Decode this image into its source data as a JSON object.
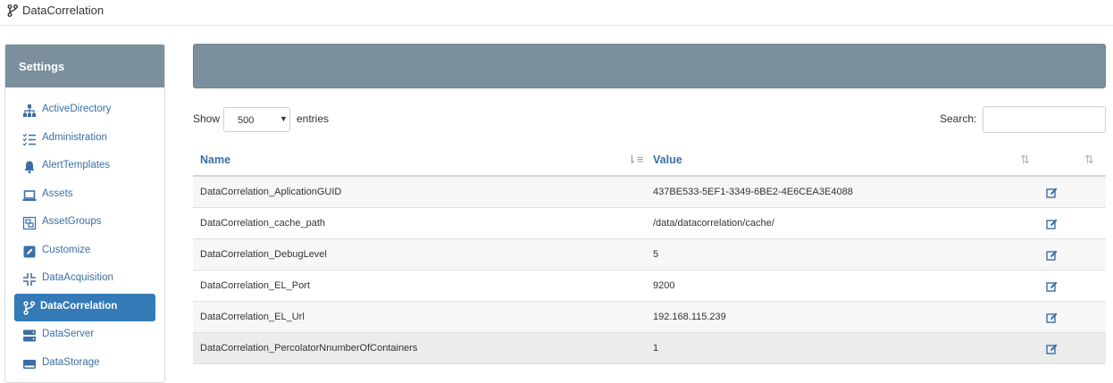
{
  "app": {
    "title": "DataCorrelation"
  },
  "sidebar": {
    "heading": "Settings",
    "items": [
      {
        "label": "ActiveDirectory",
        "icon": "sitemap-icon"
      },
      {
        "label": "Administration",
        "icon": "list-check-icon"
      },
      {
        "label": "AlertTemplates",
        "icon": "bell-icon"
      },
      {
        "label": "Assets",
        "icon": "laptop-icon"
      },
      {
        "label": "AssetGroups",
        "icon": "object-group-icon"
      },
      {
        "label": "Customize",
        "icon": "edit-square-icon"
      },
      {
        "label": "DataAcquisition",
        "icon": "compress-icon"
      },
      {
        "label": "DataCorrelation",
        "icon": "code-branch-icon",
        "active": true
      },
      {
        "label": "DataServer",
        "icon": "server-icon"
      },
      {
        "label": "DataStorage",
        "icon": "hdd-icon"
      }
    ]
  },
  "controls": {
    "show_label": "Show",
    "entries_value": "500",
    "entries_label": "entries",
    "search_label": "Search:",
    "search_value": ""
  },
  "table": {
    "columns": [
      "Name",
      "Value"
    ],
    "rows": [
      {
        "name": "DataCorrelation_AplicationGUID",
        "value": "437BE533-5EF1-3349-6BE2-4E6CEA3E4088"
      },
      {
        "name": "DataCorrelation_cache_path",
        "value": "/data/datacorrelation/cache/"
      },
      {
        "name": "DataCorrelation_DebugLevel",
        "value": "5"
      },
      {
        "name": "DataCorrelation_EL_Port",
        "value": "9200"
      },
      {
        "name": "DataCorrelation_EL_Url",
        "value": "192.168.115.239"
      },
      {
        "name": "DataCorrelation_PercolatorNnumberOfContainers",
        "value": "1"
      }
    ]
  },
  "colors": {
    "panel_header": "#7b909c",
    "link": "#3a6fa6",
    "active_bg": "#337ab7"
  }
}
